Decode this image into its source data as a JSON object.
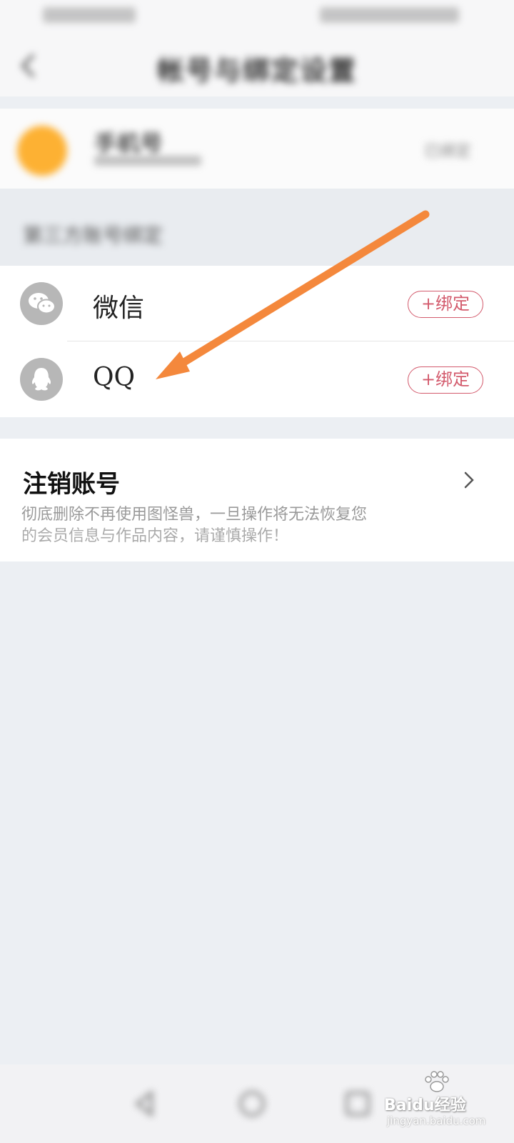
{
  "header": {
    "title": "帐号与绑定设置"
  },
  "profile": {
    "name": "手机号",
    "status": "已绑定"
  },
  "section": {
    "title": "第三方账号绑定"
  },
  "bindings": [
    {
      "icon": "wechat-icon",
      "label": "微信",
      "button": "+绑定"
    },
    {
      "icon": "qq-icon",
      "label": "QQ",
      "button": "+绑定"
    }
  ],
  "cancel_account": {
    "title": "注销账号",
    "description_line1": "彻底删除不再使用图怪兽，一旦操作将无法恢复您",
    "description_line2": "的会员信息与作品内容，请谨慎操作！"
  },
  "watermark": {
    "text": "Baidu经验",
    "url": "jingyan.baidu.com"
  },
  "colors": {
    "accent": "#d35a6c",
    "avatar": "#fdb133",
    "arrow": "#f4883c",
    "background": "#eceff3"
  }
}
